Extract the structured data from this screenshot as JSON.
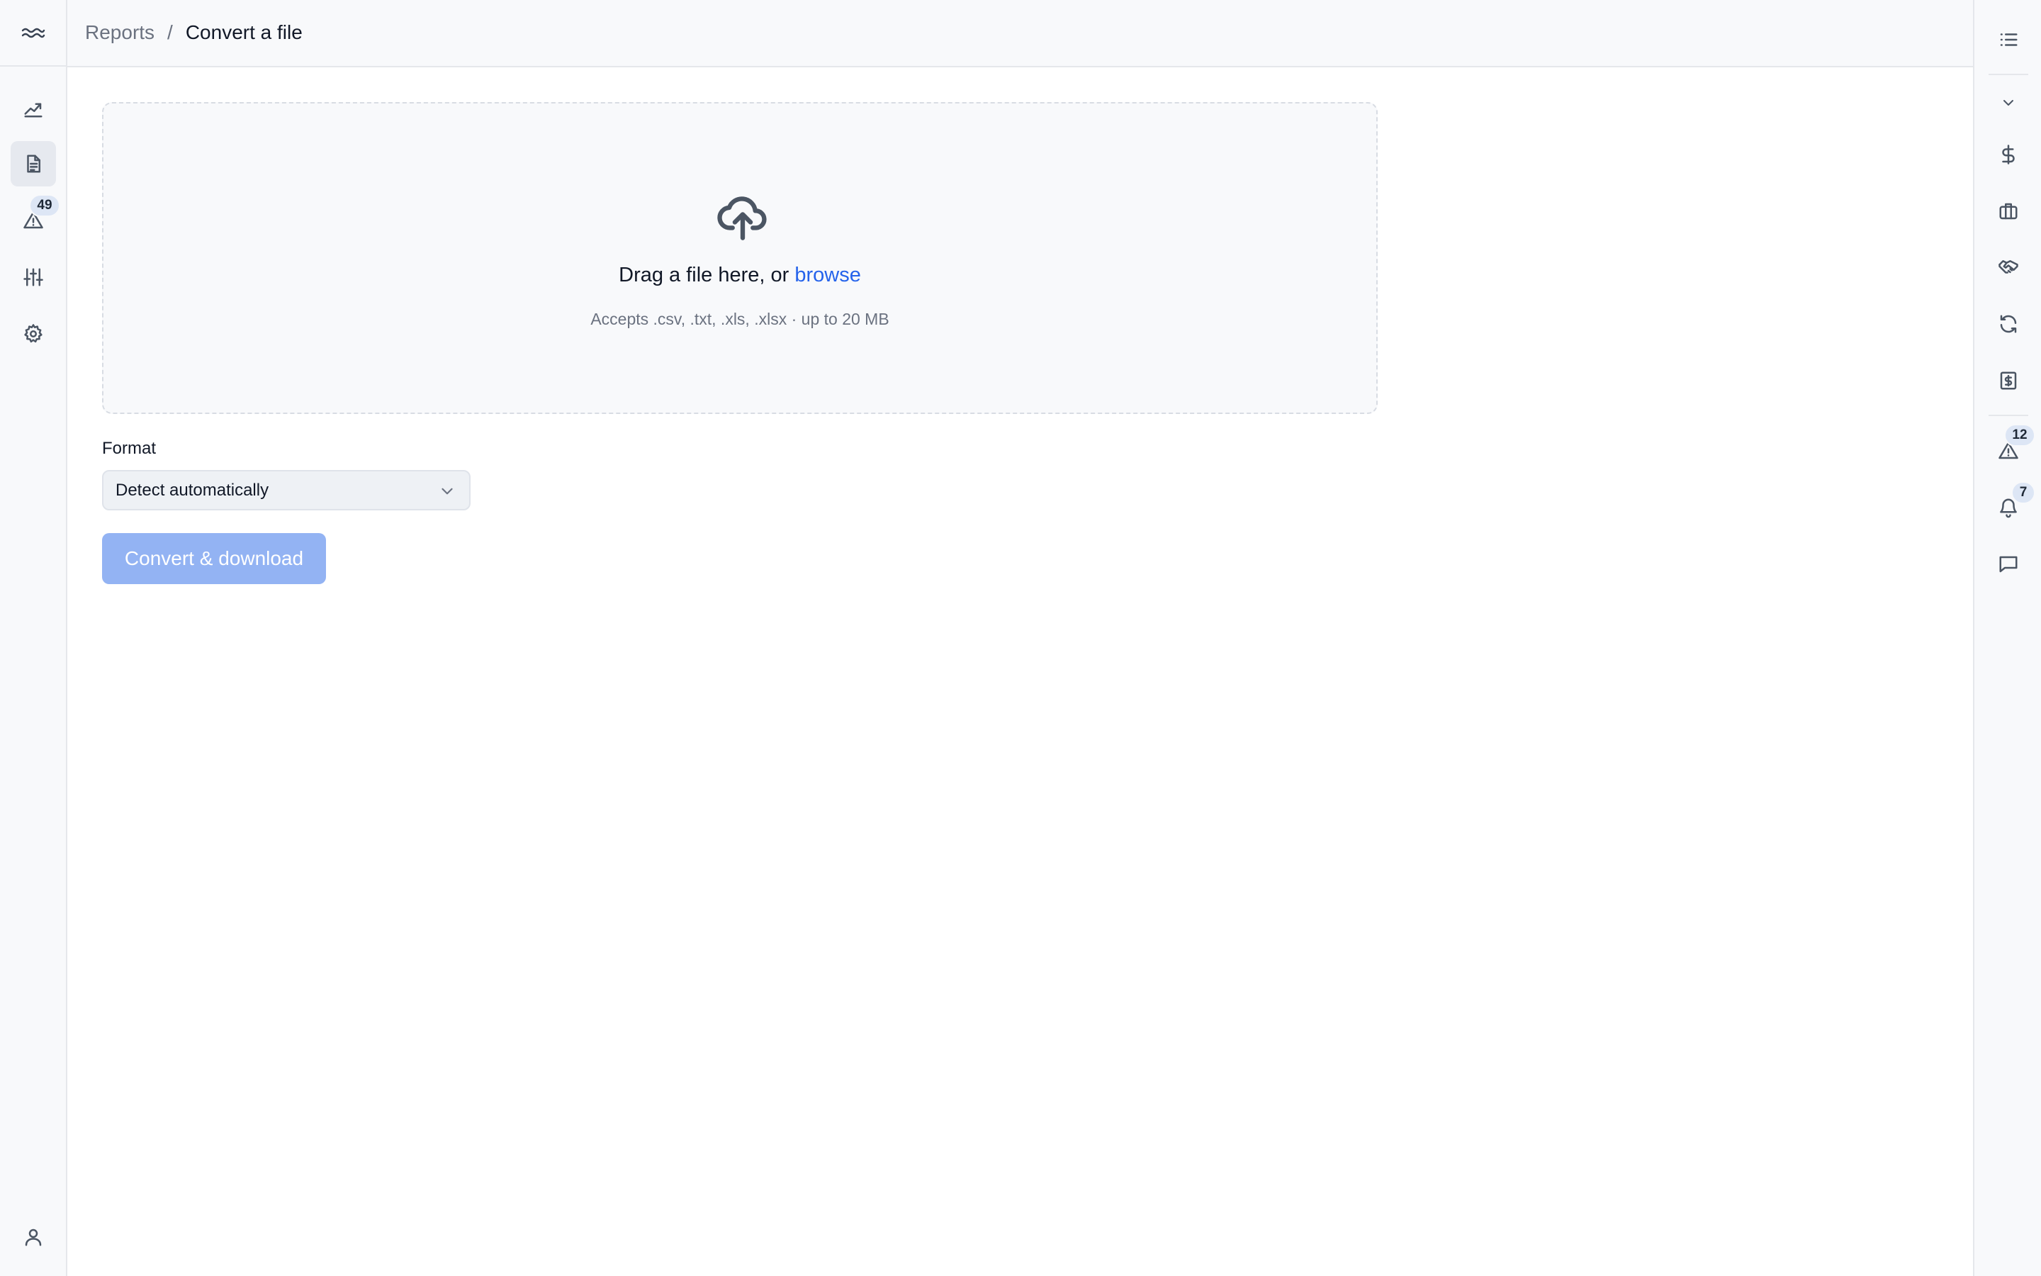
{
  "breadcrumb": {
    "parent": "Reports",
    "separator": "/",
    "current": "Convert a file"
  },
  "left_rail": {
    "items": [
      {
        "name": "analytics",
        "icon": "trending-line-icon"
      },
      {
        "name": "reports",
        "icon": "document-icon",
        "active": true
      },
      {
        "name": "alerts",
        "icon": "warning-triangle-icon",
        "badge": "49"
      },
      {
        "name": "filters",
        "icon": "sliders-icon"
      },
      {
        "name": "settings",
        "icon": "gear-icon"
      }
    ],
    "bottom": {
      "name": "account",
      "icon": "user-icon"
    }
  },
  "right_rail": {
    "items": [
      {
        "icon": "list-icon"
      },
      {
        "icon": "chevron-down-icon"
      },
      {
        "icon": "dollar-icon"
      },
      {
        "icon": "briefcase-icon"
      },
      {
        "icon": "handshake-icon"
      },
      {
        "icon": "refresh-icon"
      },
      {
        "icon": "invoice-icon"
      },
      {
        "icon": "warning-triangle-icon",
        "badge": "12"
      },
      {
        "icon": "bell-icon",
        "badge": "7"
      },
      {
        "icon": "chat-icon"
      }
    ]
  },
  "dropzone": {
    "prompt": "Drag a file here, or",
    "browse_label": "browse",
    "hint": "Accepts .csv, .txt, .xls, .xlsx · up to 20 MB"
  },
  "format": {
    "label": "Format",
    "selected": "Detect automatically"
  },
  "convert_button": {
    "label": "Convert & download",
    "disabled": true
  },
  "colors": {
    "accent": "#2563eb",
    "button_disabled": "#93b3f3",
    "rail_bg": "#f8f9fb",
    "badge_bg": "#dde6f5"
  }
}
